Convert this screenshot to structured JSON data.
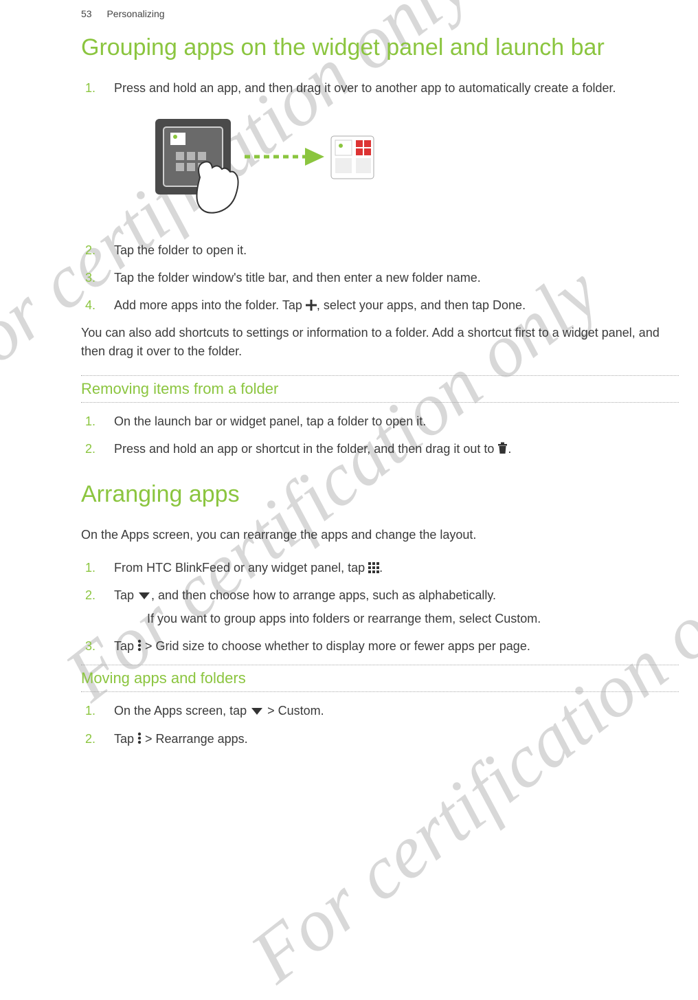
{
  "header": {
    "page_number": "53",
    "section": "Personalizing"
  },
  "watermark": "For certification only",
  "section1": {
    "title": "Grouping apps on the widget panel and launch bar",
    "steps": [
      "Press and hold an app, and then drag it over to another app to automatically create a folder.",
      "Tap the folder to open it.",
      "Tap the folder window's title bar, and then enter a new folder name.",
      {
        "pre": "Add more apps into the folder. Tap ",
        "post": ", select your apps, and then tap ",
        "bold": "Done",
        "tail": "."
      }
    ],
    "note": "You can also add shortcuts to settings or information to a folder. Add a shortcut first to a widget panel, and then drag it over to the folder."
  },
  "sub1": {
    "title": "Removing items from a folder",
    "steps": [
      "On the launch bar or widget panel, tap a folder to open it.",
      {
        "pre": "Press and hold an app or shortcut in the folder, and then drag it out to ",
        "tail": "."
      }
    ]
  },
  "section2": {
    "title": "Arranging apps",
    "intro": "On the Apps screen, you can rearrange the apps and change the layout.",
    "steps": [
      {
        "pre": "From HTC BlinkFeed or any widget panel, tap ",
        "tail": "."
      },
      {
        "pre": "Tap ",
        "post": ", and then choose how to arrange apps, such as alphabetically."
      },
      {
        "note": "If you want to group apps into folders or rearrange them, select ",
        "bold": "Custom",
        "tail": "."
      },
      {
        "pre": "Tap ",
        "mid": " > ",
        "bold": "Grid size",
        "post": " to choose whether to display more or fewer apps per page."
      }
    ]
  },
  "sub2": {
    "title": "Moving apps and folders",
    "steps": [
      {
        "pre": "On the Apps screen, tap ",
        "mid": " > ",
        "bold": "Custom",
        "tail": "."
      },
      {
        "pre": "Tap ",
        "mid": " > ",
        "bold": "Rearrange apps",
        "tail": "."
      }
    ]
  }
}
